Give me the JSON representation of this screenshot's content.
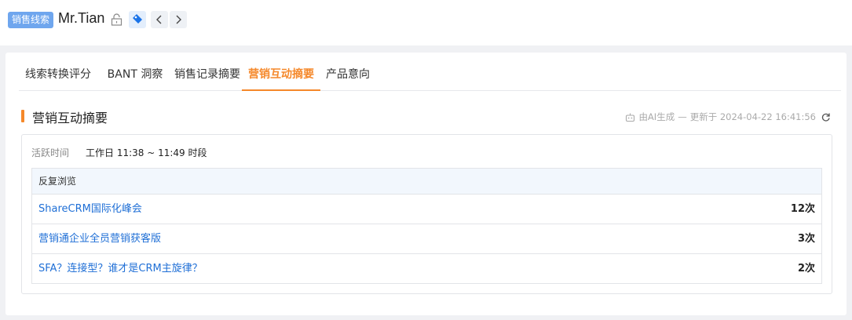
{
  "header": {
    "badge": "销售线索",
    "name": "Mr.Tian"
  },
  "tabs": [
    {
      "label": "线索转换评分"
    },
    {
      "label": "BANT 洞察"
    },
    {
      "label": "销售记录摘要"
    },
    {
      "label": "营销互动摘要"
    },
    {
      "label": "产品意向"
    }
  ],
  "active_tab": "营销互动摘要",
  "section": {
    "title": "营销互动摘要",
    "meta_source": "由AI生成",
    "meta_sep": "—",
    "meta_updated": "更新于 2024-04-22 16:41:56"
  },
  "activity": {
    "label": "活跃时间",
    "value": "工作日 11:38 ~ 11:49 时段"
  },
  "table": {
    "header": "反复浏览",
    "rows": [
      {
        "title": "ShareCRM国际化峰会",
        "count": "12次"
      },
      {
        "title": "营销通企业全员营销获客版",
        "count": "3次"
      },
      {
        "title": "SFA？连接型？谁才是CRM主旋律？",
        "count": "2次"
      }
    ]
  },
  "colors": {
    "accent": "#f5882a",
    "link": "#1f6fd6",
    "badge": "#6fa6ee"
  },
  "icons": [
    "lock-icon",
    "tag-icon",
    "chevron-left-icon",
    "chevron-right-icon",
    "robot-icon",
    "refresh-icon"
  ]
}
